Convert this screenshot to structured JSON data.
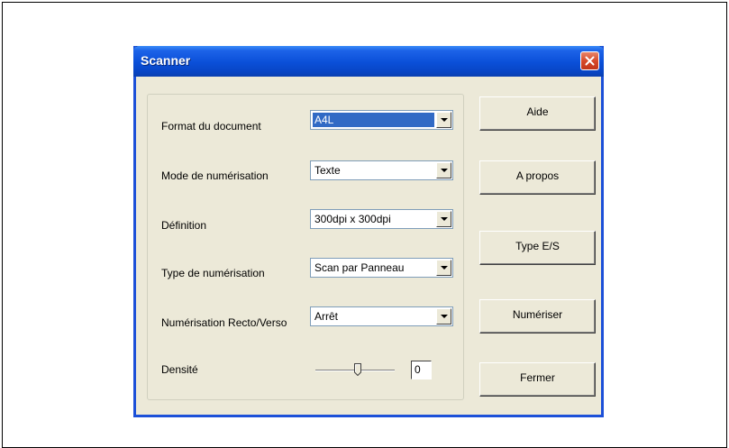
{
  "window": {
    "title": "Scanner"
  },
  "fields": [
    {
      "label": "Format du document",
      "value": "A4L",
      "selected": true
    },
    {
      "label": "Mode de numérisation",
      "value": "Texte",
      "selected": false
    },
    {
      "label": "Définition",
      "value": "300dpi x 300dpi",
      "selected": false
    },
    {
      "label": "Type de numérisation",
      "value": "Scan par Panneau",
      "selected": false
    },
    {
      "label": "Numérisation Recto/Verso",
      "value": "Arrêt",
      "selected": false
    }
  ],
  "density": {
    "label": "Densité",
    "value": "0"
  },
  "buttons": {
    "help": "Aide",
    "about": "A propos",
    "io_type": "Type E/S",
    "scan": "Numériser",
    "close": "Fermer"
  },
  "colors": {
    "titlebar": "#0a4fd8",
    "dialog_bg": "#ece9d8",
    "selection": "#316ac5",
    "close_button": "#d6492a"
  }
}
